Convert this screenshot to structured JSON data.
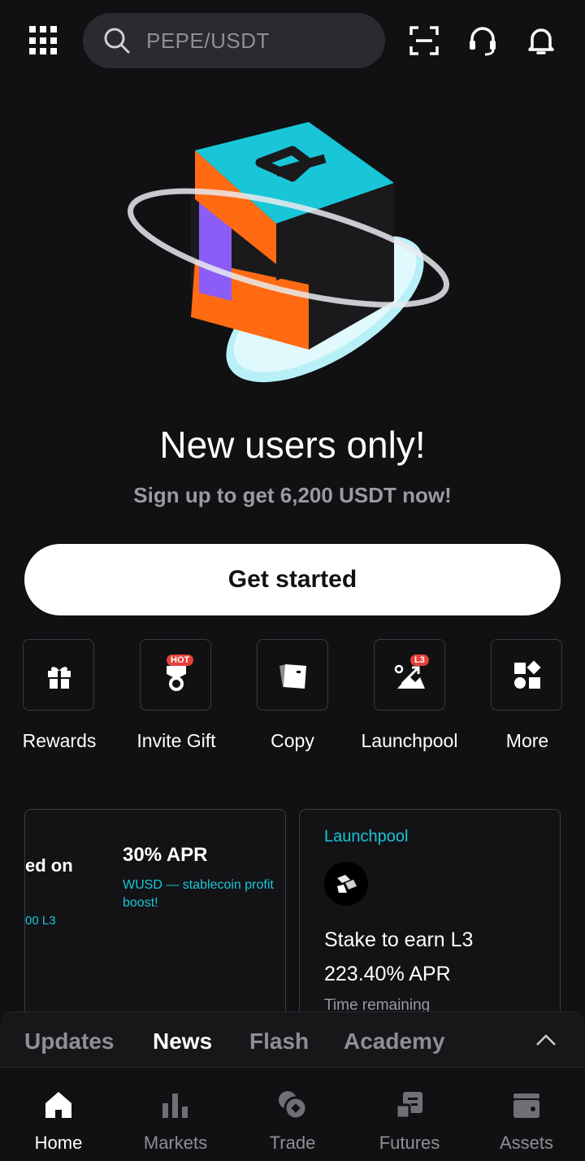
{
  "search": {
    "placeholder": "PEPE/USDT"
  },
  "hero": {
    "title": "New users only!",
    "subtitle": "Sign up to get 6,200 USDT now!",
    "cta_label": "Get started"
  },
  "quick_actions": [
    {
      "label": "Rewards",
      "icon": "gift-icon"
    },
    {
      "label": "Invite Gift",
      "icon": "medal-icon",
      "badge": "HOT"
    },
    {
      "label": "Copy",
      "icon": "copy-cards-icon"
    },
    {
      "label": "Launchpool",
      "icon": "launchpool-icon",
      "badge": "L3"
    },
    {
      "label": "More",
      "icon": "grid-shapes-icon"
    }
  ],
  "cards": {
    "card1": {
      "partial_text": "ed on",
      "partial_sub": "00 L3",
      "apr": "30% APR",
      "desc": "WUSD — stablecoin profit boost!"
    },
    "card2": {
      "tag": "Launchpool",
      "title": "Stake to earn L3",
      "apr": "223.40% APR",
      "time_label": "Time remaining"
    }
  },
  "news_tabs": [
    {
      "label": "Updates",
      "active": false
    },
    {
      "label": "News",
      "active": true
    },
    {
      "label": "Flash",
      "active": false
    },
    {
      "label": "Academy",
      "active": false
    }
  ],
  "bottom_nav": [
    {
      "label": "Home",
      "icon": "home-icon",
      "active": true
    },
    {
      "label": "Markets",
      "icon": "bar-chart-icon",
      "active": false
    },
    {
      "label": "Trade",
      "icon": "trade-icon",
      "active": false
    },
    {
      "label": "Futures",
      "icon": "futures-icon",
      "active": false
    },
    {
      "label": "Assets",
      "icon": "wallet-icon",
      "active": false
    }
  ],
  "colors": {
    "background": "#111113",
    "accent_cyan": "#18c6d8",
    "hero_orange": "#ff6a13",
    "badge_red": "#e5413b"
  }
}
